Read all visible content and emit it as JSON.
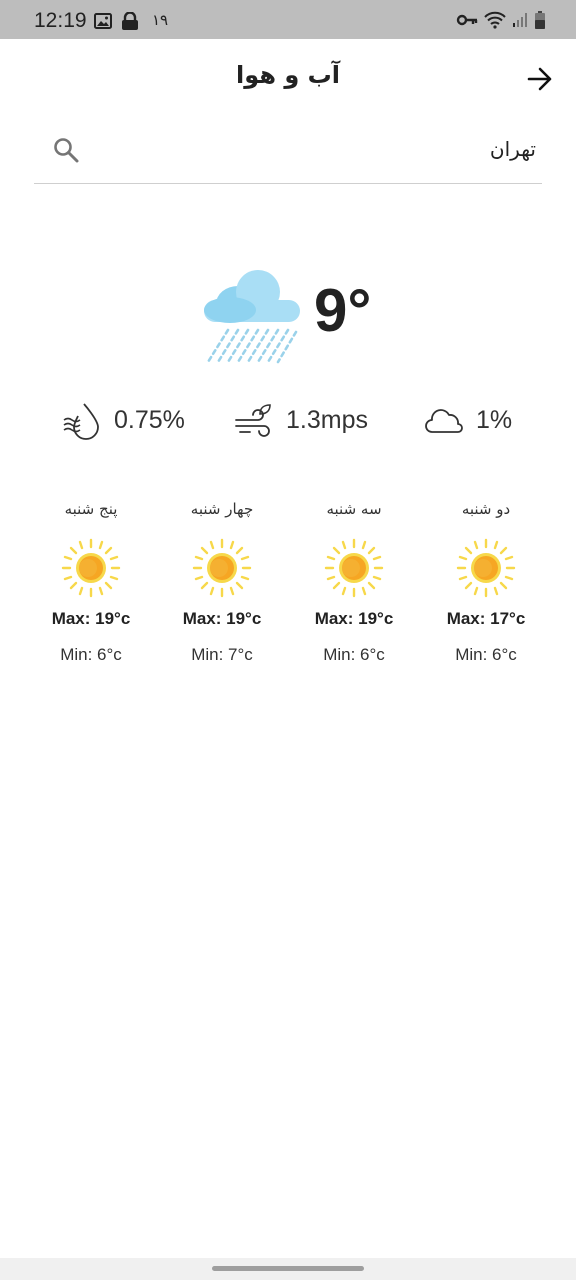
{
  "status_bar": {
    "time": "12:19",
    "notification_count": "۱۹"
  },
  "header": {
    "title": "آب و هوا"
  },
  "search": {
    "value": "تهران"
  },
  "current": {
    "temperature": "9°",
    "condition_icon": "cloud-rain-icon"
  },
  "stats": {
    "humidity": "0.75%",
    "wind": "1.3mps",
    "clouds": "1%"
  },
  "forecast": [
    {
      "day": "دو شنبه",
      "max": "Max: 17°c",
      "min": "Min: 6°c",
      "icon": "sun-icon"
    },
    {
      "day": "سه شنبه",
      "max": "Max: 19°c",
      "min": "Min: 6°c",
      "icon": "sun-icon"
    },
    {
      "day": "چهار شنبه",
      "max": "Max: 19°c",
      "min": "Min: 7°c",
      "icon": "sun-icon"
    },
    {
      "day": "پنج شنبه",
      "max": "Max: 19°c",
      "min": "Min: 6°c",
      "icon": "sun-icon"
    }
  ],
  "colors": {
    "status_bar": "#bdbdbd",
    "sun": "#f6a623",
    "sun_rays": "#f7d84a",
    "cloud": "#8fd3f0",
    "rain": "#9ad2ea"
  }
}
